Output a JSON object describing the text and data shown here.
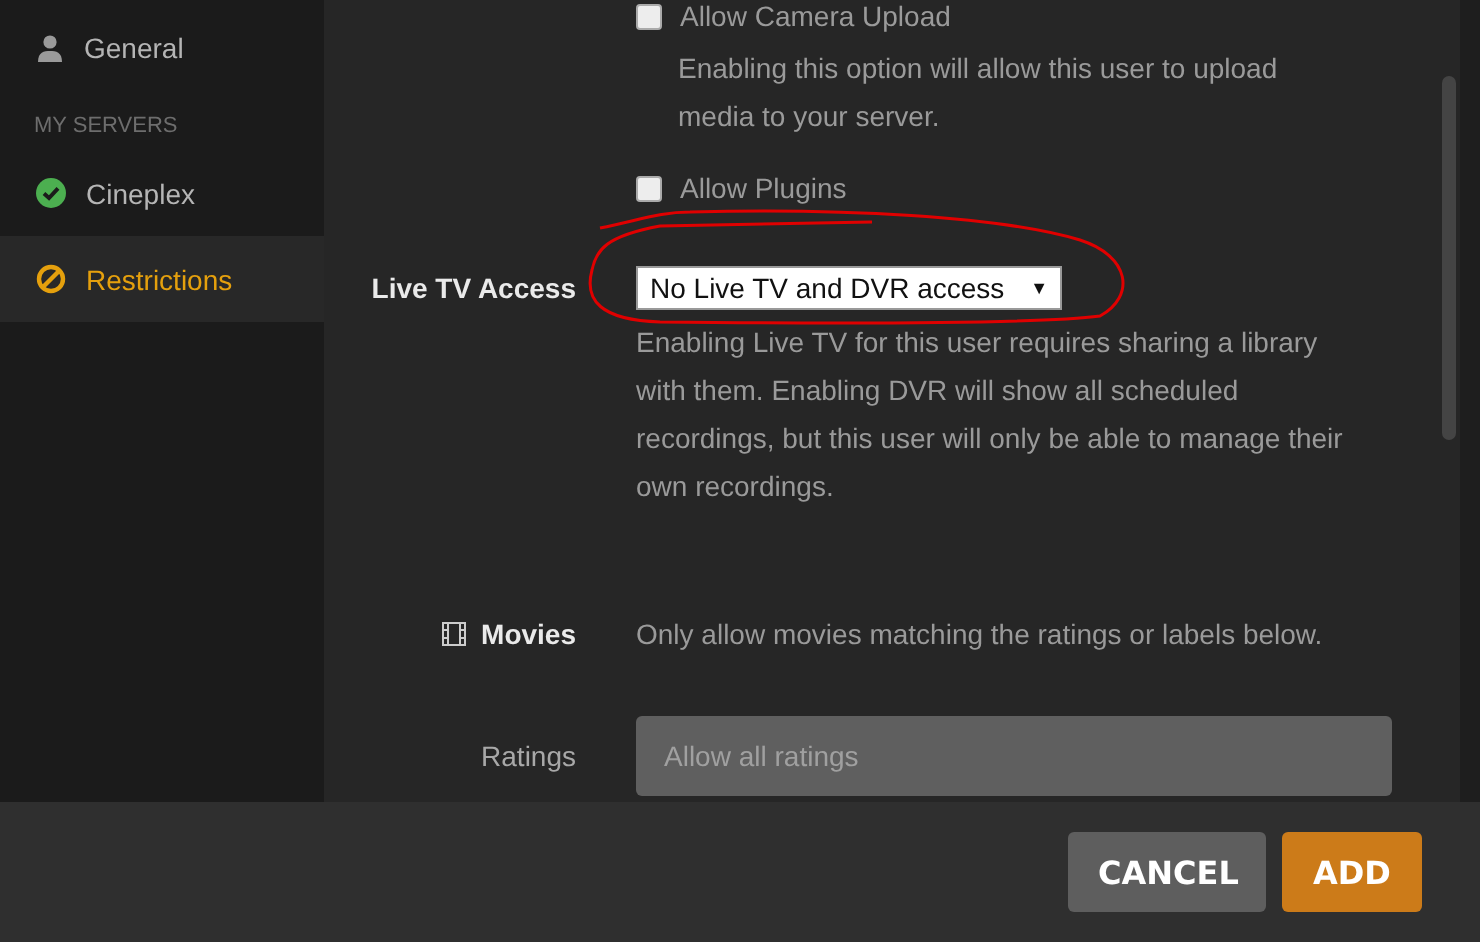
{
  "sidebar": {
    "general": {
      "label": "General",
      "selected": false
    },
    "section_header": "MY SERVERS",
    "servers": [
      {
        "label": "Cineplex",
        "selected": false,
        "online": true
      }
    ],
    "restrictions": {
      "label": "Restrictions",
      "selected": true
    }
  },
  "settings": {
    "camera_upload": {
      "label": "Allow Camera Upload",
      "checked": false,
      "description": "Enabling this option will allow this user to upload media to your server."
    },
    "plugins": {
      "label": "Allow Plugins",
      "checked": false
    },
    "live_tv": {
      "label": "Live TV Access",
      "value": "No Live TV and DVR access",
      "caret": "▼",
      "description": "Enabling Live TV for this user requires sharing a library with them. Enabling DVR will show all scheduled recordings, but this user will only be able to manage their own recordings."
    },
    "movies": {
      "label": "Movies",
      "description": "Only allow movies matching the ratings or labels below."
    },
    "ratings": {
      "label": "Ratings",
      "placeholder": "Allow all ratings"
    }
  },
  "buttons": [
    {
      "label": "CANCEL",
      "kind": "secondary"
    },
    {
      "label": "ADD",
      "kind": "primary"
    }
  ]
}
